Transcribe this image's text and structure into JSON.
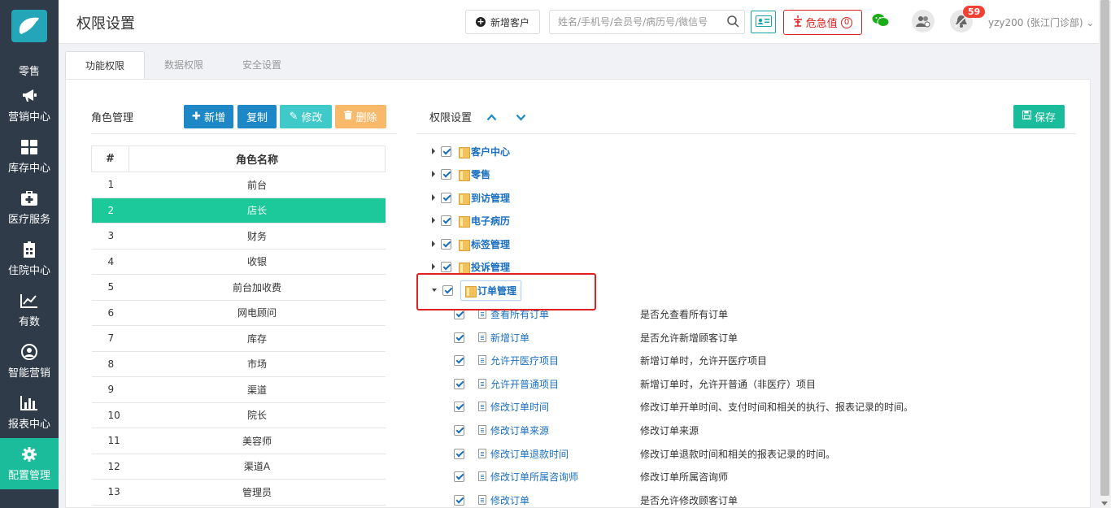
{
  "sidebar": {
    "items": [
      {
        "label": "零售",
        "icon": "retail-icon"
      },
      {
        "label": "营销中心",
        "icon": "megaphone-icon"
      },
      {
        "label": "库存中心",
        "icon": "grid-icon"
      },
      {
        "label": "医疗服务",
        "icon": "medical-kit-icon"
      },
      {
        "label": "住院中心",
        "icon": "hospital-icon"
      },
      {
        "label": "有数",
        "icon": "trend-chart-icon"
      },
      {
        "label": "智能营销",
        "icon": "smart-user-icon"
      },
      {
        "label": "报表中心",
        "icon": "bar-chart-icon"
      },
      {
        "label": "配置管理",
        "icon": "gear-icon"
      }
    ],
    "active_color": "#1bbc9b"
  },
  "header": {
    "title": "权限设置",
    "add_customer": "新增客户",
    "search_placeholder": "姓名/手机号/会员号/病历号/微信号",
    "urgent_label": "危急值",
    "urgent_count": "0",
    "notification_count": "59",
    "user": "yzy200 (张江门诊部)"
  },
  "tabs": [
    "功能权限",
    "数据权限",
    "安全设置"
  ],
  "roles": {
    "title": "角色管理",
    "buttons": {
      "new": "新增",
      "copy": "复制",
      "edit": "修改",
      "delete": "删除"
    },
    "columns": [
      "#",
      "角色名称"
    ],
    "rows": [
      {
        "num": "1",
        "name": "前台"
      },
      {
        "num": "2",
        "name": "店长"
      },
      {
        "num": "3",
        "name": "财务"
      },
      {
        "num": "4",
        "name": "收银"
      },
      {
        "num": "5",
        "name": "前台加收费"
      },
      {
        "num": "6",
        "name": "网电顾问"
      },
      {
        "num": "7",
        "name": "库存"
      },
      {
        "num": "8",
        "name": "市场"
      },
      {
        "num": "9",
        "name": "渠道"
      },
      {
        "num": "10",
        "name": "院长"
      },
      {
        "num": "11",
        "name": "美容师"
      },
      {
        "num": "12",
        "name": "渠道A"
      },
      {
        "num": "13",
        "name": "管理员"
      }
    ],
    "selected_num": "2"
  },
  "permissions": {
    "title": "权限设置",
    "save": "保存",
    "modules": [
      "客户中心",
      "零售",
      "到访管理",
      "电子病历",
      "标签管理",
      "投诉管理",
      "订单管理"
    ],
    "expanded_module": "订单管理",
    "items": [
      {
        "label": "查看所有订单",
        "desc": "是否允查看所有订单"
      },
      {
        "label": "新增订单",
        "desc": "是否允许新增顾客订单"
      },
      {
        "label": "允许开医疗项目",
        "desc": "新增订单时，允许开医疗项目"
      },
      {
        "label": "允许开普通项目",
        "desc": "新增订单时，允许开普通（非医疗）项目"
      },
      {
        "label": "修改订单时间",
        "desc": "修改订单开单时间、支付时间和相关的执行、报表记录的时间。"
      },
      {
        "label": "修改订单来源",
        "desc": "修改订单来源"
      },
      {
        "label": "修改订单退款时间",
        "desc": "修改订单退款时间和相关的报表记录的时间。"
      },
      {
        "label": "修改订单所属咨询师",
        "desc": "修改订单所属咨询师"
      },
      {
        "label": "修改订单",
        "desc": "是否允许修改顾客订单"
      }
    ]
  }
}
